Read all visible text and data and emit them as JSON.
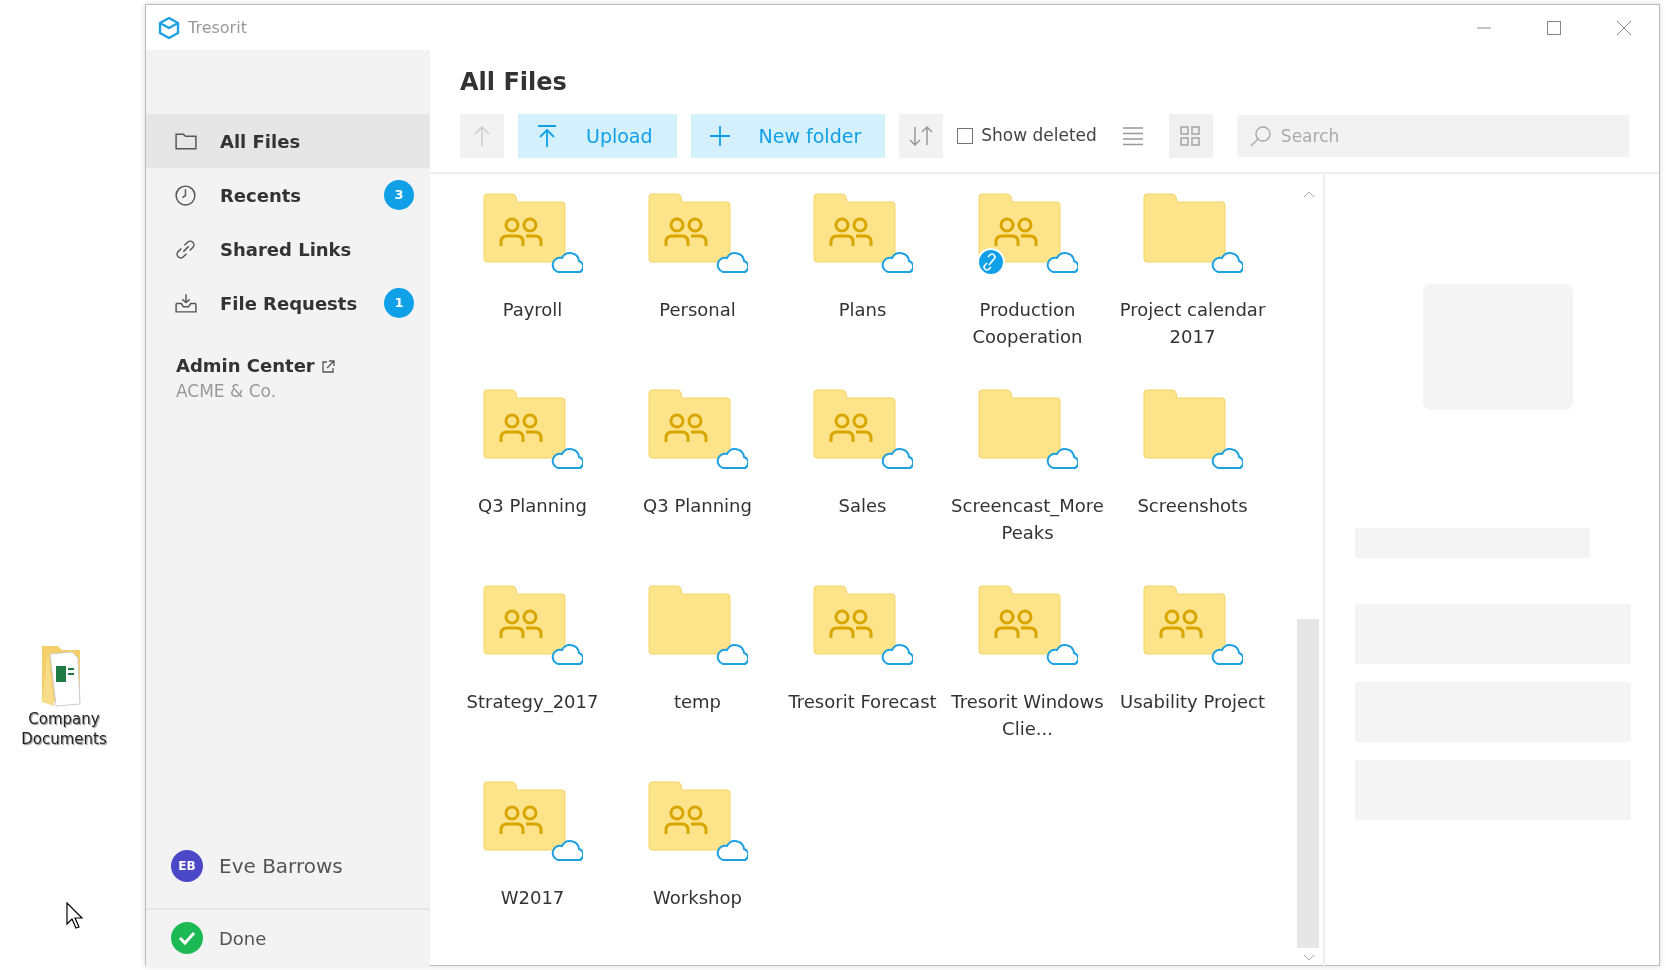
{
  "desktop": {
    "icon_label": "Company Documents"
  },
  "window": {
    "title": "Tresorit"
  },
  "sidebar": {
    "items": [
      {
        "label": "All Files",
        "selected": true
      },
      {
        "label": "Recents",
        "selected": false,
        "badge": "3"
      },
      {
        "label": "Shared Links",
        "selected": false
      },
      {
        "label": "File Requests",
        "selected": false,
        "badge": "1"
      }
    ],
    "admin": {
      "label": "Admin Center",
      "company": "ACME & Co."
    },
    "user": {
      "initials": "EB",
      "name": "Eve Barrows"
    },
    "status": "Done"
  },
  "main": {
    "heading": "All Files",
    "toolbar": {
      "upload": "Upload",
      "new_folder": "New folder",
      "show_deleted": {
        "label": "Show deleted",
        "checked": false
      },
      "views": [
        {
          "kind": "list",
          "selected": false
        },
        {
          "kind": "grid",
          "selected": true
        }
      ],
      "search_placeholder": "Search"
    },
    "folders": [
      {
        "name": "Payroll",
        "kind": "shared",
        "link": false
      },
      {
        "name": "Personal",
        "kind": "shared",
        "link": false
      },
      {
        "name": "Plans",
        "kind": "shared",
        "link": false
      },
      {
        "name": "Production Cooperation",
        "kind": "shared",
        "link": true
      },
      {
        "name": "Project calendar 2017",
        "kind": "plain",
        "link": false
      },
      {
        "name": "Q3 Planning",
        "kind": "shared",
        "link": false
      },
      {
        "name": "Q3 Planning",
        "kind": "shared",
        "link": false
      },
      {
        "name": "Sales",
        "kind": "shared",
        "link": false
      },
      {
        "name": "Screencast_MorePeaks",
        "kind": "plain",
        "link": false
      },
      {
        "name": "Screenshots",
        "kind": "plain",
        "link": false
      },
      {
        "name": "Strategy_2017",
        "kind": "shared",
        "link": false
      },
      {
        "name": "temp",
        "kind": "plain",
        "link": false
      },
      {
        "name": "Tresorit Forecast",
        "kind": "shared",
        "link": false
      },
      {
        "name": "Tresorit Windows Clie...",
        "kind": "shared",
        "link": false
      },
      {
        "name": "Usability Project",
        "kind": "shared",
        "link": false
      },
      {
        "name": "W2017",
        "kind": "shared",
        "link": false
      },
      {
        "name": "Workshop",
        "kind": "shared",
        "link": false
      }
    ]
  }
}
